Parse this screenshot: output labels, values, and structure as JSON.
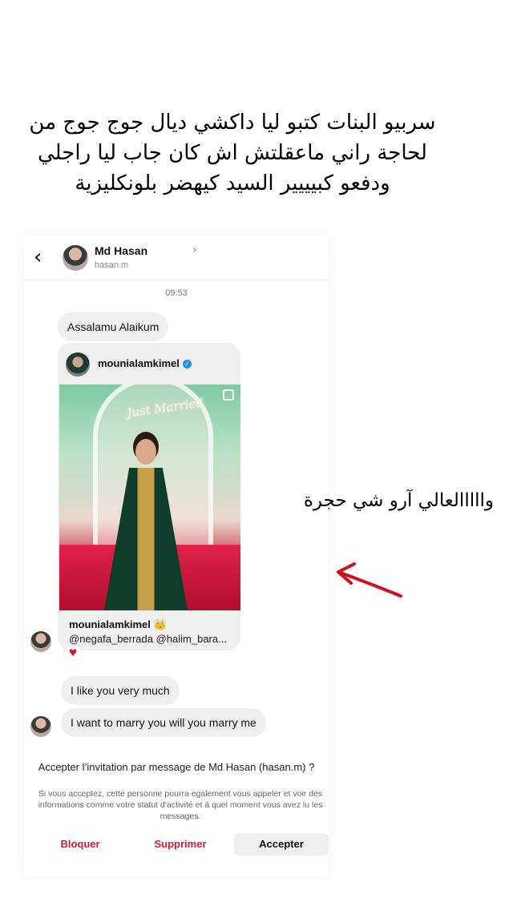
{
  "caption": {
    "line1": "سربيو البنات كتبو ليا داكشي ديال جوج جوج من",
    "line2": "لحاجة راني ماعقلتش اش كان جاب ليا راجلي",
    "line3": "ودفعو كبيييير السيد كيهضر بلونكليزية"
  },
  "header": {
    "back_icon": "chevron-left-icon",
    "name": "Md Hasan",
    "chevron": "›",
    "username": "hasan.m"
  },
  "chat": {
    "timestamp": "09:53",
    "greeting": "Assalamu Alaikum",
    "post": {
      "username": "mounialamkimel",
      "verified_mark": "✓",
      "neon_sign": "Just Married",
      "caption_user": "mounialamkimel 👑",
      "caption_text": "@negafa_berrada @halim_bara..."
    },
    "reaction": "♥",
    "message1": "I like you very much",
    "message2": "I want to marry you will you marry me"
  },
  "request": {
    "title": "Accepter l’invitation par message de Md Hasan (hasan.m) ?",
    "description": "Si vous acceptez, cette personne pourra egalement vous appeler et voir des informations comme votre statut d’activité et à quel moment vous avez lu les messages.",
    "block_label": "Bloquer",
    "delete_label": "Supprimer",
    "accept_label": "Accepter"
  },
  "annotation": {
    "text": "وااااالعالي آرو شي حجرة",
    "arrow_color": "#d0101c"
  }
}
